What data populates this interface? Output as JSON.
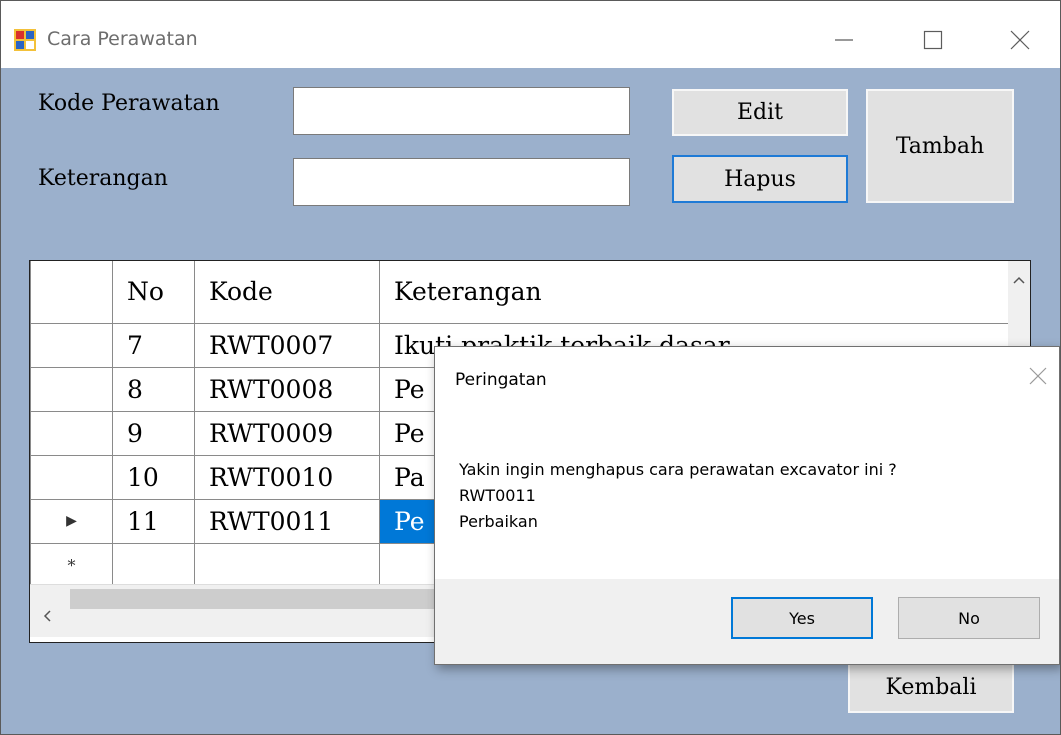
{
  "window": {
    "title": "Cara Perawatan",
    "background": "#9bb0cc"
  },
  "form": {
    "kode_label": "Kode Perawatan",
    "kode_value": "",
    "keterangan_label": "Keterangan",
    "keterangan_value": "",
    "edit_label": "Edit",
    "hapus_label": "Hapus",
    "tambah_label": "Tambah",
    "kembali_label": "Kembali"
  },
  "grid": {
    "columns": [
      "No",
      "Kode",
      "Keterangan"
    ],
    "rows": [
      {
        "no": "7",
        "kode": "RWT0007",
        "keterangan": "Ikuti praktik terbaik dasar"
      },
      {
        "no": "8",
        "kode": "RWT0008",
        "keterangan": "Pe"
      },
      {
        "no": "9",
        "kode": "RWT0009",
        "keterangan": "Pe"
      },
      {
        "no": "10",
        "kode": "RWT0010",
        "keterangan": "Pa"
      },
      {
        "no": "11",
        "kode": "RWT0011",
        "keterangan": "Pe"
      }
    ],
    "selected_row": "11",
    "new_row_marker": "*",
    "current_row_marker": "▶"
  },
  "dialog": {
    "title": "Peringatan",
    "message": "Yakin ingin menghapus cara perawatan excavator ini ?",
    "line2": "RWT0011",
    "line3": "Perbaikan",
    "yes_label": "Yes",
    "no_label": "No"
  },
  "colors": {
    "selection": "#0078d7",
    "focus_border": "#1e7ad6"
  }
}
